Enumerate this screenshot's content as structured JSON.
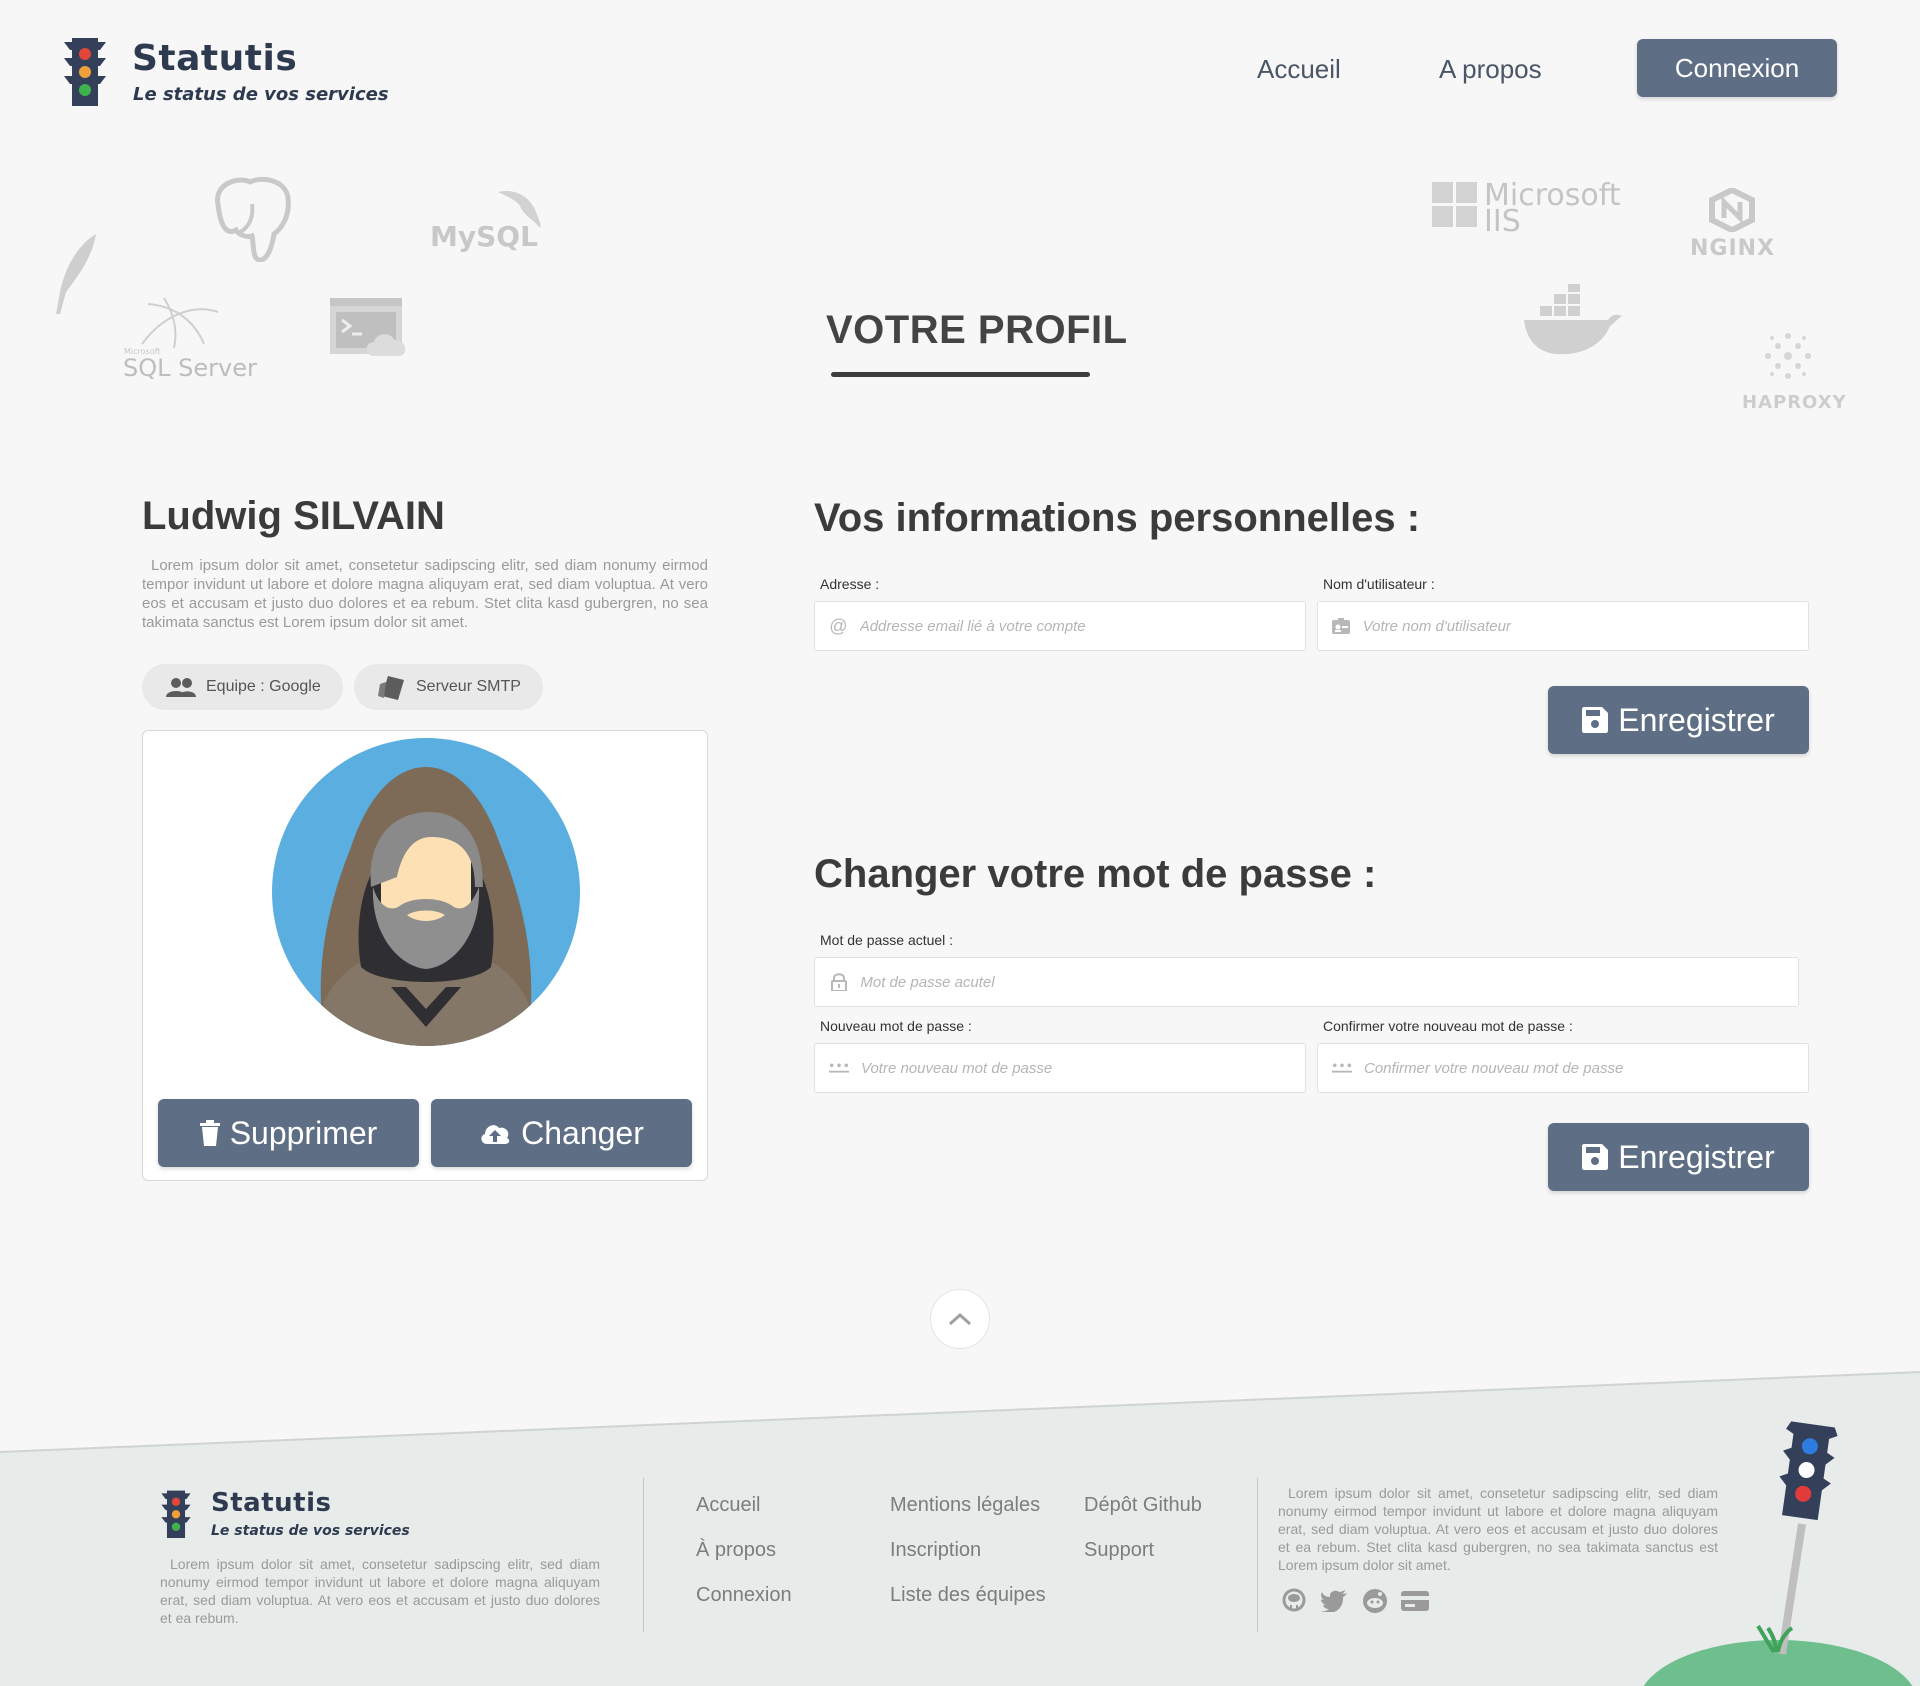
{
  "header": {
    "brand_name": "Statutis",
    "brand_tagline": "Le status de vos services",
    "nav": [
      {
        "label": "Accueil"
      },
      {
        "label": "A propos"
      }
    ],
    "login_label": "Connexion"
  },
  "decor_logos": {
    "mysql": "MySQL",
    "sqlserver_small": "Microsoft",
    "sqlserver": "SQL Server",
    "iis_top": "Microsoft",
    "iis_bottom": "IIS",
    "nginx": "NGINX",
    "haproxy": "HAPROXY"
  },
  "page": {
    "title": "VOTRE PROFIL"
  },
  "profile": {
    "name": "Ludwig SILVAIN",
    "bio": "Lorem ipsum dolor sit amet, consetetur sadipscing elitr, sed diam nonumy eirmod tempor invidunt ut labore et dolore magna aliquyam erat, sed diam voluptua. At vero eos et accusam et justo duo dolores et ea rebum. Stet clita kasd gubergren, no sea takimata sanctus est Lorem ipsum dolor sit amet.",
    "chips": [
      {
        "label": "Equipe : Google",
        "icon": "users-icon"
      },
      {
        "label": "Serveur SMTP",
        "icon": "server-icon"
      }
    ],
    "delete_label": "Supprimer",
    "change_label": "Changer"
  },
  "personal_info": {
    "title": "Vos informations personnelles :",
    "address_label": "Adresse :",
    "address_placeholder": "Addresse email lié à votre compte",
    "username_label": "Nom d'utilisateur :",
    "username_placeholder": "Votre nom d'utilisateur",
    "save_label": "Enregistrer"
  },
  "password": {
    "title": "Changer votre mot de passe :",
    "current_label": "Mot de passe actuel :",
    "current_placeholder": "Mot de passe acutel",
    "new_label": "Nouveau mot de passe :",
    "new_placeholder": "Votre nouveau mot de passe",
    "confirm_label": "Confirmer votre nouveau mot de passe :",
    "confirm_placeholder": "Confirmer votre nouveau mot de passe",
    "save_label": "Enregistrer"
  },
  "footer": {
    "brand_name": "Statutis",
    "brand_tagline": "Le status de vos services",
    "about_text": "Lorem ipsum dolor sit amet, consetetur sadipscing elitr, sed diam nonumy eirmod tempor invidunt ut labore et dolore magna aliquyam erat, sed diam voluptua. At vero eos et accusam et justo duo dolores et ea rebum.",
    "col1": [
      "Accueil",
      "À propos",
      "Connexion"
    ],
    "col2": [
      "Mentions légales",
      "Inscription",
      "Liste des équipes"
    ],
    "col3": [
      "Dépôt Github",
      "Support"
    ],
    "right_text": "Lorem ipsum dolor sit amet, consetetur sadipscing elitr, sed diam nonumy eirmod tempor invidunt ut labore et dolore magna aliquyam erat, sed diam voluptua. At vero eos et accusam et justo duo dolores et ea rebum. Stet clita kasd gubergren, no sea takimata sanctus est Lorem ipsum dolor sit amet.",
    "social_icons": [
      "github-icon",
      "twitter-icon",
      "reddit-icon",
      "card-icon"
    ]
  },
  "colors": {
    "primary_button": "#5e6e84",
    "brand_dark": "#2e3a4f",
    "footer_bg": "#e7ebea",
    "avatar_bg": "#5aaee0"
  }
}
